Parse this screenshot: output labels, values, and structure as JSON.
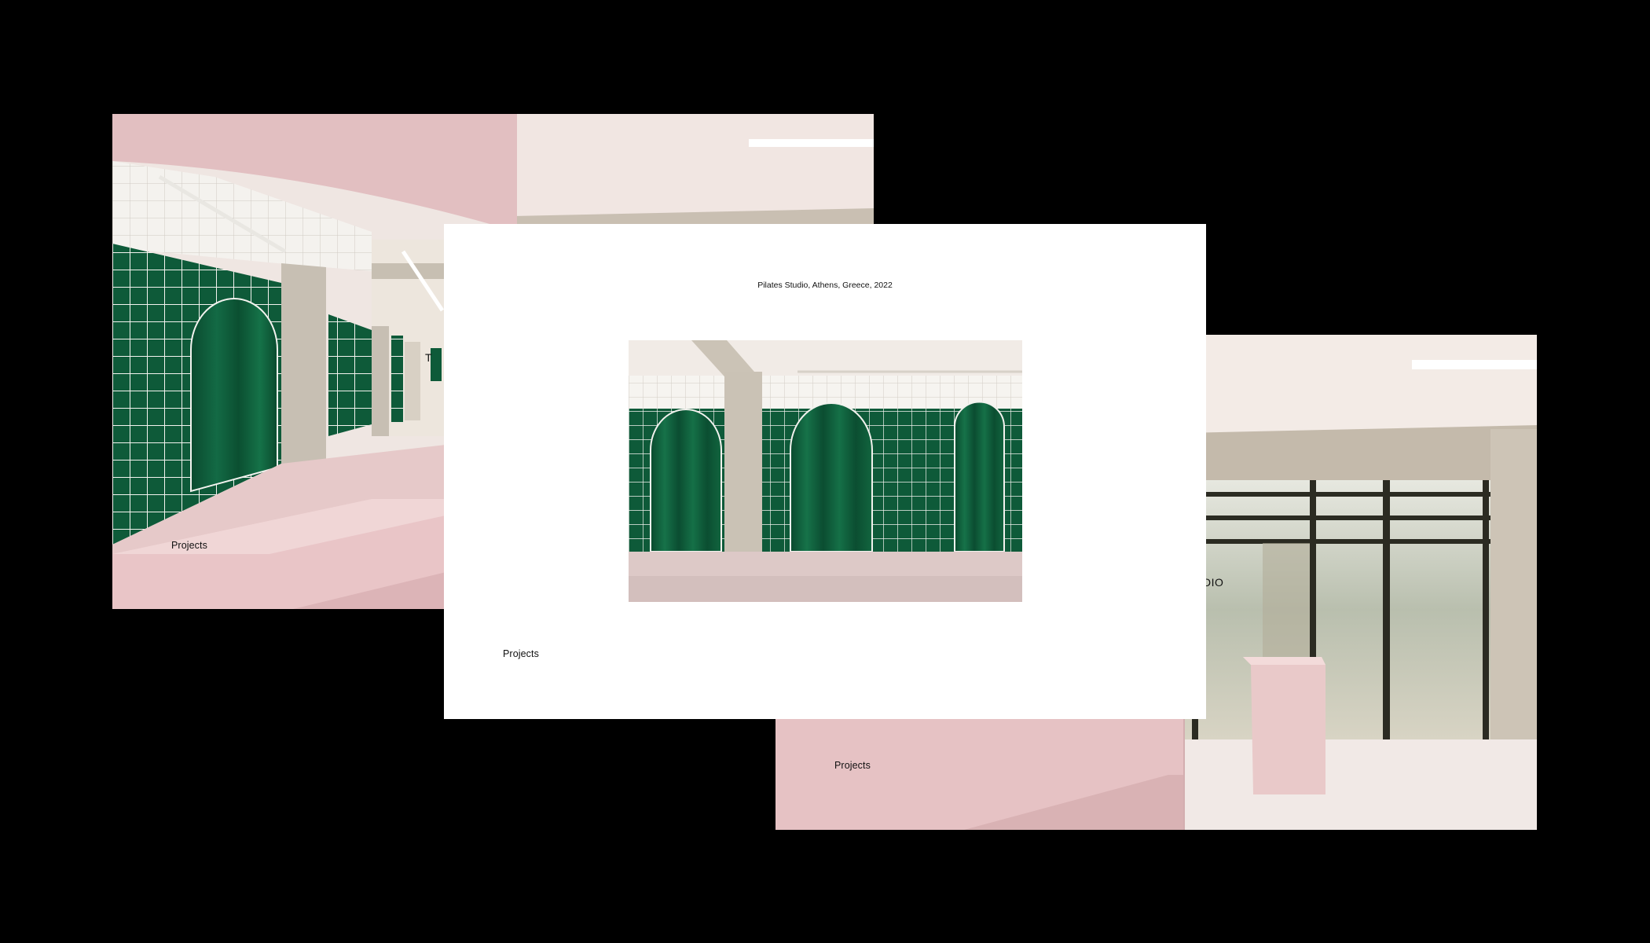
{
  "screens": {
    "left": {
      "nav_link": "Projects",
      "overlay_text": "T"
    },
    "center": {
      "project_title": "Pilates Studio, Athens, Greece, 2022",
      "nav_link": "Projects"
    },
    "right": {
      "nav_link": "Projects",
      "overlay_text": "DIO"
    }
  },
  "colors": {
    "background": "#000000",
    "blush_pink": "#e8c3c6",
    "velvet_green": "#0f5a3a",
    "concrete": "#c9c1b2",
    "white": "#ffffff"
  }
}
